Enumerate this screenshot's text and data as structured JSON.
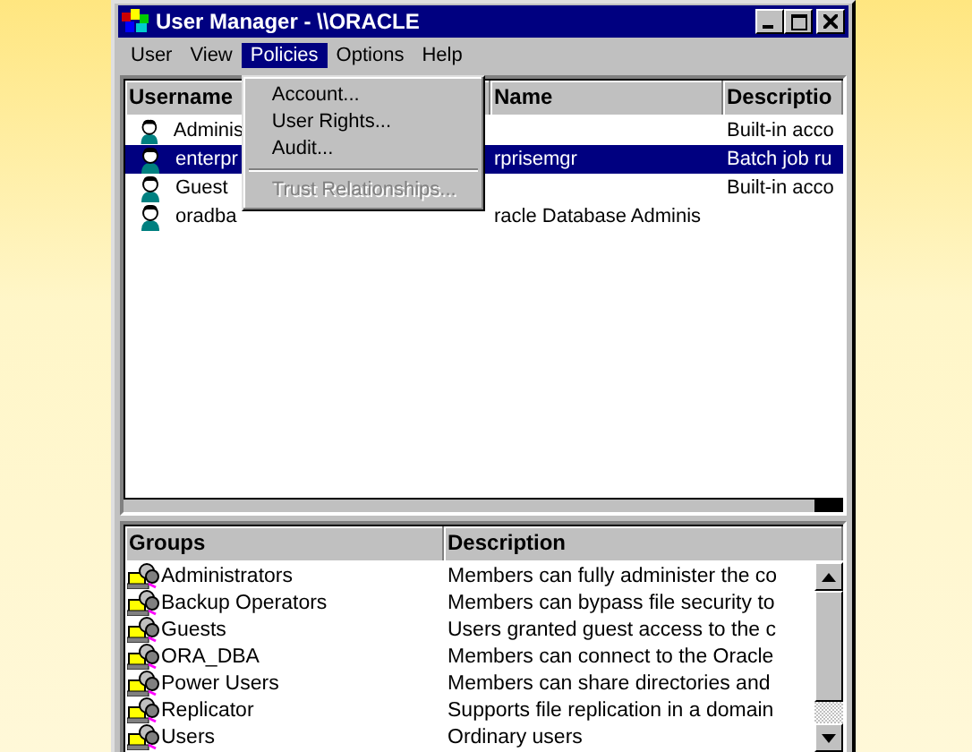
{
  "window": {
    "title": "User Manager - \\\\ORACLE"
  },
  "menu_bar": [
    {
      "label": "User",
      "selected": false
    },
    {
      "label": "View",
      "selected": false
    },
    {
      "label": "Policies",
      "selected": true
    },
    {
      "label": "Options",
      "selected": false
    },
    {
      "label": "Help",
      "selected": false
    }
  ],
  "open_menu": {
    "items": [
      {
        "kind": "item",
        "label": "Account...",
        "disabled": false
      },
      {
        "kind": "item",
        "label": "User Rights...",
        "disabled": false
      },
      {
        "kind": "item",
        "label": "Audit...",
        "disabled": false
      },
      {
        "kind": "separator"
      },
      {
        "kind": "item",
        "label": "Trust Relationships...",
        "disabled": true
      }
    ]
  },
  "users": {
    "columns": [
      "Username",
      "Name",
      "Descriptio"
    ],
    "rows": [
      {
        "username": "Adminis",
        "description": "Built-in acco",
        "selected": false
      },
      {
        "username": "enterpr",
        "full_name": "rprisemgr",
        "description": "Batch job ru",
        "selected": true
      },
      {
        "username": "Guest",
        "description": "Built-in acco",
        "selected": false
      },
      {
        "username": "oradba",
        "full_name": "racle Database Adminis",
        "selected": false
      }
    ]
  },
  "groups": {
    "columns": [
      "Groups",
      "Description"
    ],
    "rows": [
      {
        "name": "Administrators",
        "description": "Members can fully administer the co"
      },
      {
        "name": "Backup Operators",
        "description": "Members can bypass file security to"
      },
      {
        "name": "Guests",
        "description": "Users granted guest access to the c"
      },
      {
        "name": "ORA_DBA",
        "description": "Members can connect to the Oracle"
      },
      {
        "name": "Power Users",
        "description": "Members can share directories and"
      },
      {
        "name": "Replicator",
        "description": "Supports file replication in a domain"
      },
      {
        "name": "Users",
        "description": "Ordinary users"
      }
    ]
  }
}
